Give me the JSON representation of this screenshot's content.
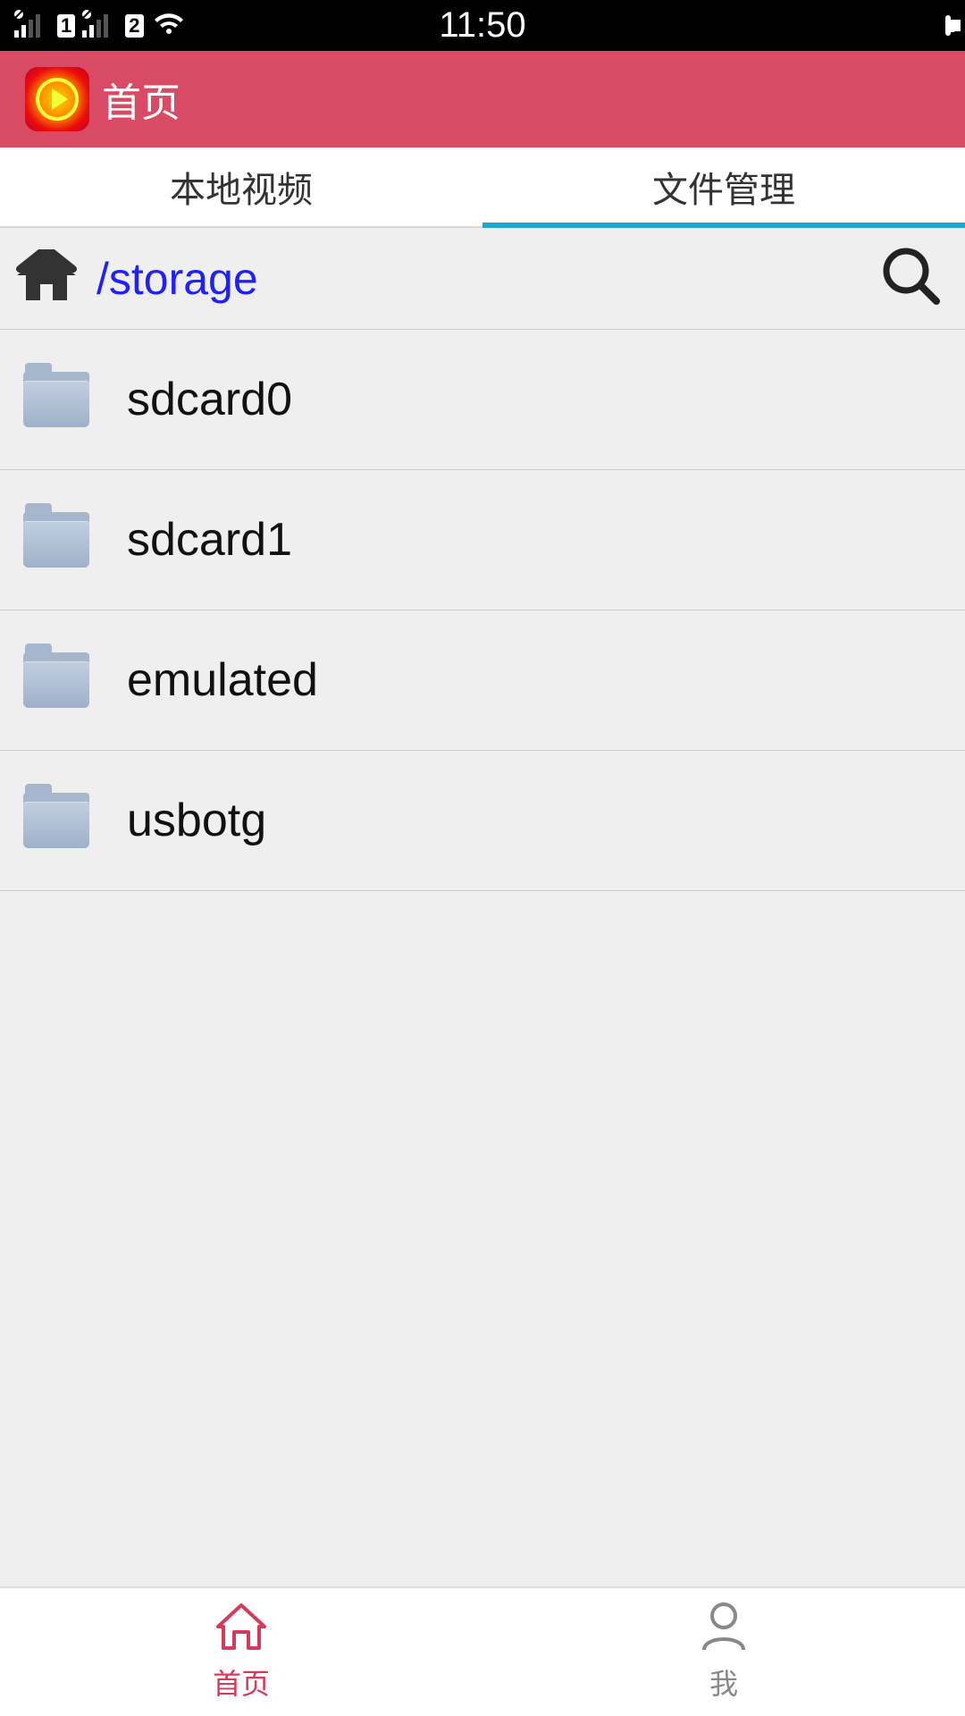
{
  "status": {
    "time": "11:50",
    "sim1": "1",
    "sim2": "2"
  },
  "header": {
    "title": "首页"
  },
  "tabs": {
    "local_video": "本地视频",
    "file_manager": "文件管理"
  },
  "path": {
    "current": "/storage"
  },
  "files": [
    {
      "name": "sdcard0"
    },
    {
      "name": "sdcard1"
    },
    {
      "name": "emulated"
    },
    {
      "name": "usbotg"
    }
  ],
  "bottom_nav": {
    "home": "首页",
    "me": "我"
  },
  "icons": {
    "home": "home-icon",
    "search": "search-icon",
    "folder": "folder-icon",
    "person": "person-icon",
    "app_logo": "play-logo-icon",
    "signal": "signal-icon",
    "wifi": "wifi-icon",
    "battery": "battery-icon",
    "nav_home": "nav-home-icon"
  }
}
